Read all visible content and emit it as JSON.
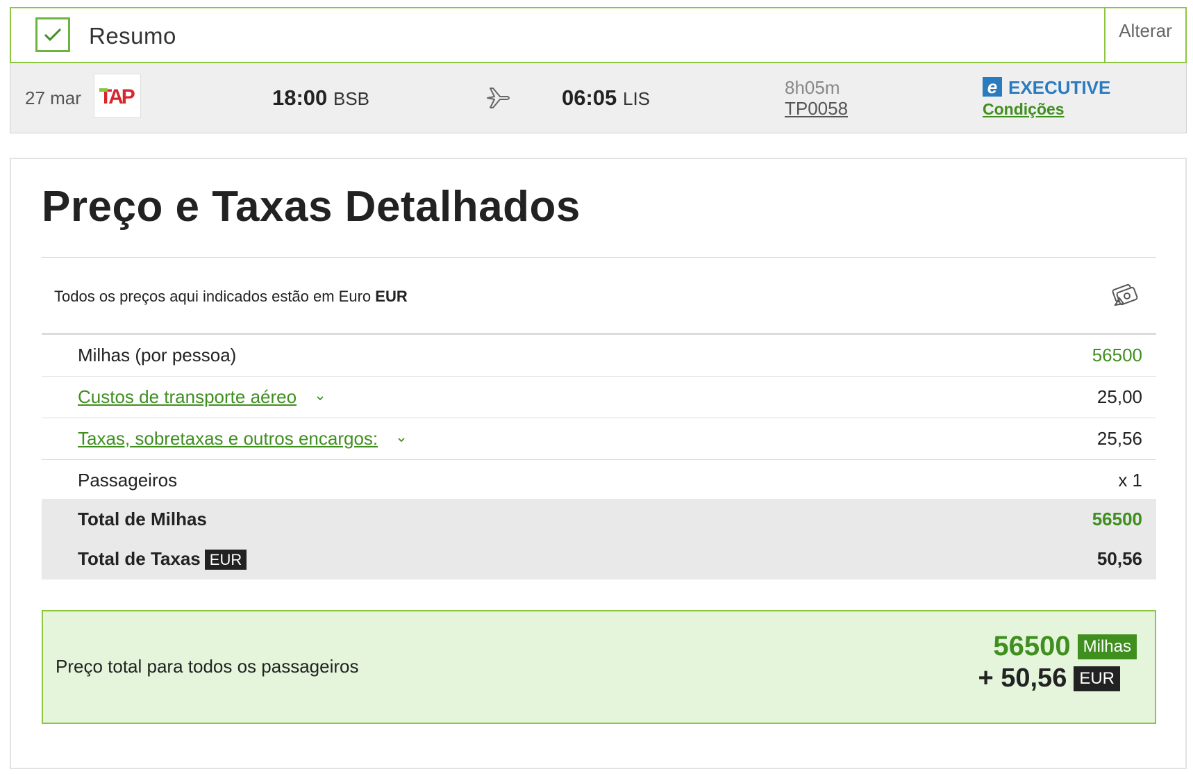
{
  "summary": {
    "title": "Resumo",
    "change_label": "Alterar"
  },
  "flight": {
    "date": "27 mar",
    "airline_logo_text": "TAP",
    "departure_time": "18:00",
    "departure_airport": "BSB",
    "arrival_time": "06:05",
    "arrival_airport": "LIS",
    "duration": "8h05m",
    "flight_number": "TP0058",
    "cabin_badge": "e",
    "cabin": "EXECUTIVE",
    "conditions_label": "Condições"
  },
  "price": {
    "heading": "Preço e Taxas Detalhados",
    "currency_note_prefix": "Todos os preços aqui indicados estão em Euro",
    "currency_note_code": "EUR",
    "rows": [
      {
        "label": "Milhas (por pessoa)",
        "value": "56500"
      },
      {
        "label": "Custos de transporte aéreo",
        "value": "25,00"
      },
      {
        "label": "Taxas, sobretaxas e outros encargos:",
        "value": "25,56"
      },
      {
        "label": "Passageiros",
        "value": "x 1"
      }
    ],
    "total_miles": {
      "label": "Total de Milhas",
      "value": "56500"
    },
    "total_taxes": {
      "label": "Total de Taxas",
      "tag": "EUR",
      "value": "50,56"
    },
    "grand_total": {
      "label": "Preço total para todos os passageiros",
      "miles": "56500",
      "miles_tag": "Milhas",
      "eur": "+ 50,56",
      "eur_tag": "EUR"
    }
  },
  "colors": {
    "accent_green": "#3f8f1f",
    "border_green": "#8cc63f",
    "executive_blue": "#2b7bbf",
    "total_bg": "#e4f5dc"
  }
}
